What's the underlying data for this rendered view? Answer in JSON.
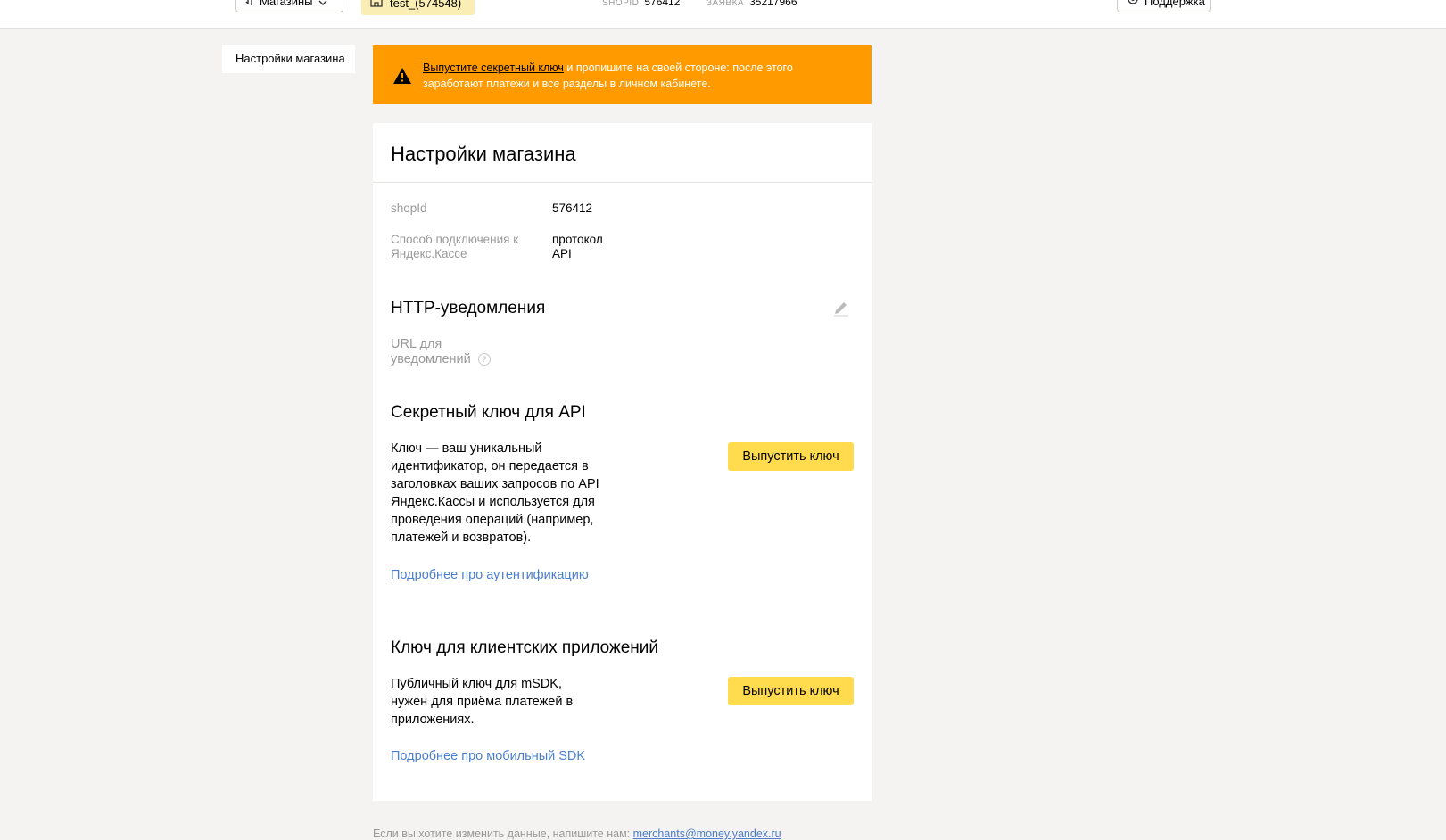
{
  "header": {
    "shops_label": "Магазины",
    "shop_chip": "test_(574548)",
    "shopid_key": "shopId",
    "shopid_value": "576412",
    "app_key": "ЗАЯВКА",
    "app_value": "35217966",
    "support_label": "Поддержка"
  },
  "nav": {
    "items": [
      {
        "label": "Настройки магазина"
      }
    ]
  },
  "banner": {
    "link_text": "Выпустите секретный ключ",
    "text": " и пропишите на своей стороне: после этого заработают платежи и все разделы в личном кабинете."
  },
  "card": {
    "title": "Настройки магазина",
    "fields": [
      {
        "label": "shopId",
        "value": "576412"
      },
      {
        "label": "Способ подключения к Яндекс.Кассе",
        "value": "протокол API"
      }
    ],
    "http": {
      "title": "HTTP-уведомления",
      "url_label": "URL для уведомлений",
      "help_glyph": "?"
    },
    "secret": {
      "title": "Секретный ключ для API",
      "description": "Ключ — ваш уникальный идентификатор, он передается в заголовках ваших запросов по API Яндекс.Кассы и используется для проведения операций (например, платежей и возвратов).",
      "button": "Выпустить ключ",
      "link": "Подробнее про аутентификацию"
    },
    "client": {
      "title": "Ключ для клиентских приложений",
      "description": "Публичный ключ для mSDK, нужен для приёма платежей в приложениях.",
      "button": "Выпустить ключ",
      "link": "Подробнее про мобильный SDK"
    }
  },
  "footer": {
    "text": "Если вы хотите изменить данные, напишите нам: ",
    "email": "merchants@money.yandex.ru"
  },
  "colors": {
    "banner": "#ff9b00",
    "button": "#ffdb4d",
    "link": "#4b7ecb",
    "background": "#f4f3f1"
  }
}
